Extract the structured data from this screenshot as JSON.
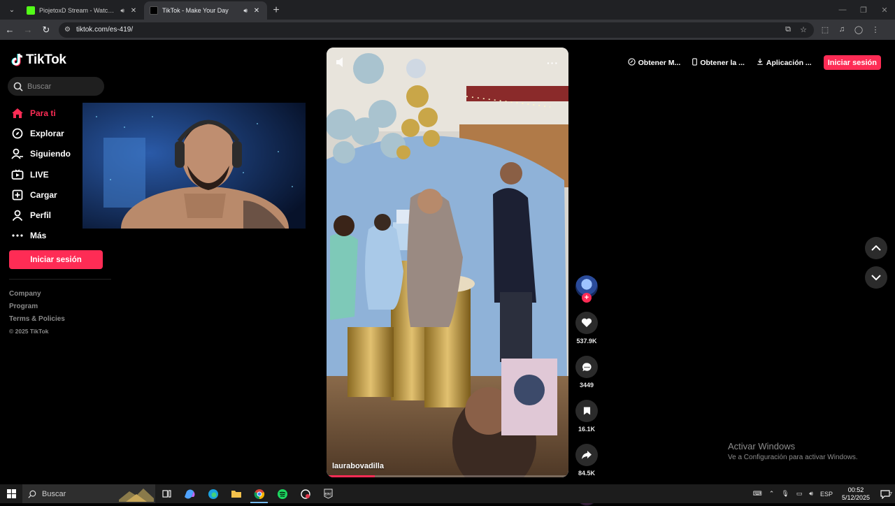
{
  "browser": {
    "tabs": [
      {
        "title": "PiojetoxD Stream - Watch Live",
        "active": false
      },
      {
        "title": "TikTok - Make Your Day",
        "active": true
      }
    ],
    "url": "tiktok.com/es-419/"
  },
  "sidebar": {
    "logo_text": "TikTok",
    "search_placeholder": "Buscar",
    "items": [
      {
        "label": "Para ti",
        "icon": "home-icon",
        "active": true
      },
      {
        "label": "Explorar",
        "icon": "compass-icon"
      },
      {
        "label": "Siguiendo",
        "icon": "following-icon"
      },
      {
        "label": "LIVE",
        "icon": "live-icon"
      },
      {
        "label": "Cargar",
        "icon": "upload-icon"
      },
      {
        "label": "Perfil",
        "icon": "profile-icon"
      },
      {
        "label": "Más",
        "icon": "more-icon"
      }
    ],
    "login_label": "Iniciar sesión",
    "footer": [
      "Company",
      "Program",
      "Terms & Policies"
    ],
    "copyright": "© 2025 TikTok"
  },
  "header": {
    "links": [
      {
        "label": "Obtener M...",
        "icon": "coin-icon"
      },
      {
        "label": "Obtener la ...",
        "icon": "phone-icon"
      },
      {
        "label": "Aplicación ...",
        "icon": "download-icon"
      }
    ],
    "login_label": "Iniciar sesión"
  },
  "video": {
    "username": "laurabovadilla",
    "progress": 0.2,
    "stats": {
      "likes": "537.9K",
      "comments": "3449",
      "saves": "16.1K",
      "shares": "84.5K"
    }
  },
  "watermark": {
    "title": "Activar Windows",
    "subtitle": "Ve a Configuración para activar Windows."
  },
  "taskbar": {
    "search_placeholder": "Buscar",
    "language": "ESP",
    "time": "00:52",
    "date": "5/12/2025",
    "notifications": "7"
  },
  "colors": {
    "accent": "#fe2c55",
    "background": "#000000"
  }
}
